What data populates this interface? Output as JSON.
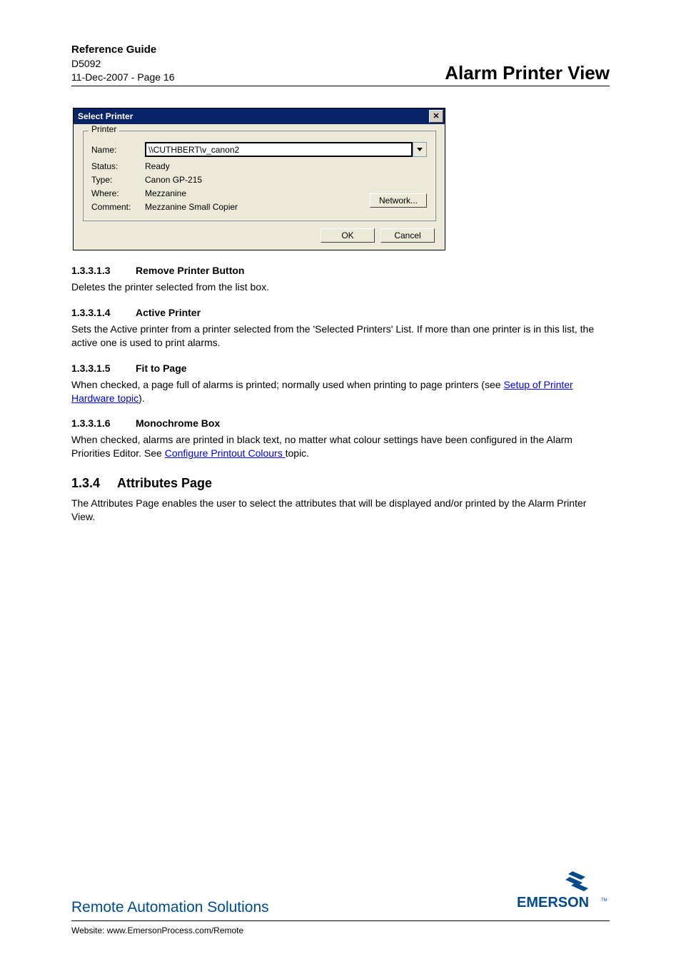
{
  "header": {
    "title": "Reference Guide",
    "docnum": "D5092",
    "dateline": "11-Dec-2007 - Page 16",
    "right_title": "Alarm Printer View"
  },
  "dialog": {
    "title": "Select Printer",
    "fieldset_label": "Printer",
    "name_label": "Name:",
    "name_value": "\\\\CUTHBERT\\v_canon2",
    "status_label": "Status:",
    "status_value": "Ready",
    "type_label": "Type:",
    "type_value": "Canon GP-215",
    "where_label": "Where:",
    "where_value": "Mezzanine",
    "comment_label": "Comment:",
    "comment_value": "Mezzanine Small Copier",
    "network_button": "Network...",
    "ok_button": "OK",
    "cancel_button": "Cancel"
  },
  "sections": {
    "s1": {
      "num": "1.3.3.1.3",
      "title": "Remove Printer Button",
      "body": "Deletes the printer selected from the list box."
    },
    "s2": {
      "num": "1.3.3.1.4",
      "title": "Active Printer",
      "body": "Sets the Active printer from a printer selected from the 'Selected Printers' List. If more than one printer is in this list, the active one is used to print alarms."
    },
    "s3": {
      "num": "1.3.3.1.5",
      "title": "Fit to Page",
      "body_before": "When checked, a page full of alarms is printed; normally used when printing to page printers (see ",
      "link": "Setup of Printer Hardware topic",
      "body_after": ")."
    },
    "s4": {
      "num": "1.3.3.1.6",
      "title": "Monochrome Box",
      "body_before": "When checked, alarms are printed in black text, no matter what colour settings have been configured in the Alarm Priorities Editor. See ",
      "link": "Configure Printout Colours ",
      "body_after": "topic."
    },
    "s5": {
      "num": "1.3.4",
      "title": "Attributes Page",
      "body": "The Attributes Page enables the user to select the attributes that will be displayed and/or printed by the Alarm Printer View."
    }
  },
  "footer": {
    "left": "Remote Automation Solutions",
    "website_label": "Website:  www.EmersonProcess.com/Remote",
    "logo_text": "EMERSON"
  }
}
